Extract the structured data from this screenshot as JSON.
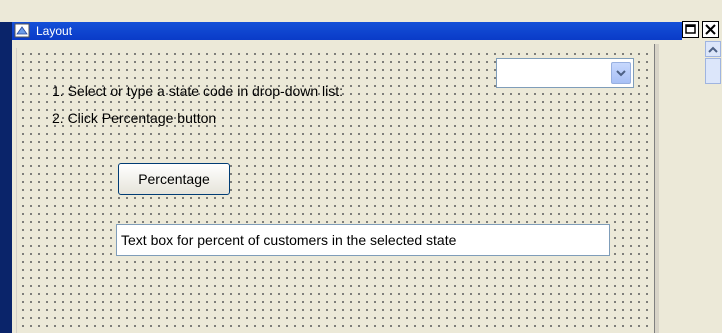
{
  "window": {
    "title": "Layout",
    "icons": {
      "app": "layout-form-icon",
      "maximize": "maximize-icon",
      "close": "close-icon"
    }
  },
  "form": {
    "instruction_1": "1. Select or type a state code in drop-down list:",
    "instruction_2": "2. Click Percentage button",
    "state_dropdown": {
      "value": "",
      "arrow_icon": "chevron-down-icon"
    },
    "percentage_button": "Percentage",
    "result_textbox": "Text box for percent of customers in the selected state"
  },
  "scrollbar": {
    "up_icon": "chevron-up-icon"
  },
  "colors": {
    "titlebar": "#0a3bc8",
    "background": "#ece9d8"
  }
}
